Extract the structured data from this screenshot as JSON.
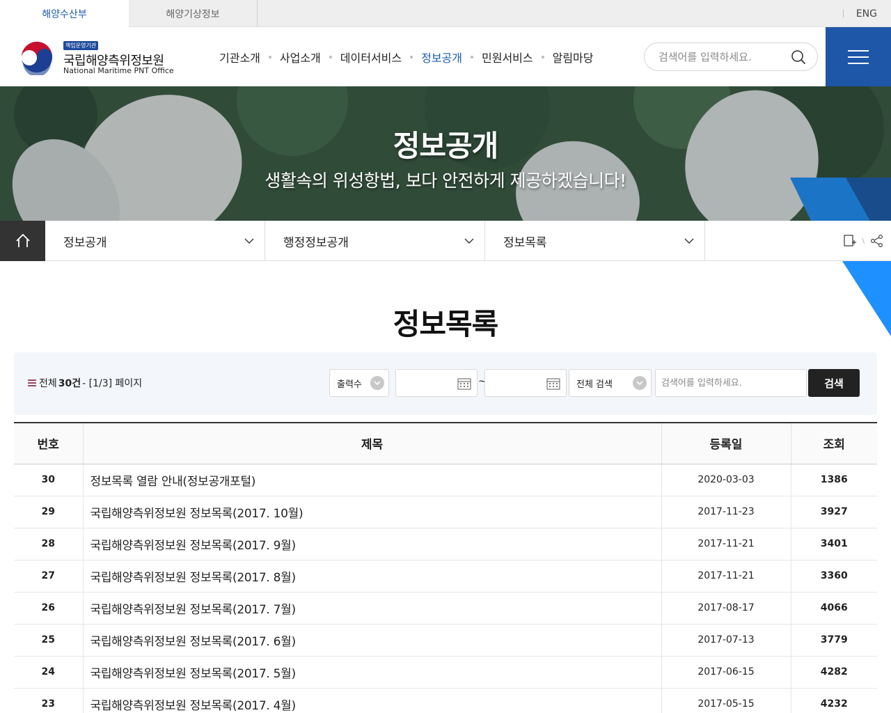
{
  "topbar": {
    "tabs": [
      "해양수산부",
      "해양기상정보"
    ],
    "lang": "ENG"
  },
  "header": {
    "badge": "책임운영기관",
    "org_ko": "국립해양측위정보원",
    "org_en": "National Maritime PNT Office",
    "nav": [
      "기관소개",
      "사업소개",
      "데이터서비스",
      "정보공개",
      "민원서비스",
      "알림마당"
    ],
    "active_nav": "정보공개",
    "search_placeholder": "검색어를 입력하세요."
  },
  "banner": {
    "title": "정보공개",
    "subtitle": "생활속의 위성항법, 보다 안전하게 제공하겠습니다!"
  },
  "location": {
    "items": [
      "정보공개",
      "행정정보공개",
      "정보목록"
    ]
  },
  "page": {
    "title": "정보목록"
  },
  "filter": {
    "total_prefix": "전체",
    "total_count": "30건",
    "page_info": "- [1/3] 페이지",
    "per_page_label": "출력수",
    "tilde": "~",
    "scope_label": "전체 검색",
    "keyword_placeholder": "검색어를 입력하세요.",
    "search_button": "검색"
  },
  "table": {
    "headers": [
      "번호",
      "제목",
      "등록일",
      "조회"
    ],
    "rows": [
      {
        "no": "30",
        "title": "정보목록 열람 안내(정보공개포털)",
        "date": "2020-03-03",
        "hits": "1386"
      },
      {
        "no": "29",
        "title": "국립해양측위정보원 정보목록(2017. 10월)",
        "date": "2017-11-23",
        "hits": "3927"
      },
      {
        "no": "28",
        "title": "국립해양측위정보원 정보목록(2017. 9월)",
        "date": "2017-11-21",
        "hits": "3401"
      },
      {
        "no": "27",
        "title": "국립해양측위정보원 정보목록(2017. 8월)",
        "date": "2017-11-21",
        "hits": "3360"
      },
      {
        "no": "26",
        "title": "국립해양측위정보원 정보목록(2017. 7월)",
        "date": "2017-08-17",
        "hits": "4066"
      },
      {
        "no": "25",
        "title": "국립해양측위정보원 정보목록(2017. 6월)",
        "date": "2017-07-13",
        "hits": "3779"
      },
      {
        "no": "24",
        "title": "국립해양측위정보원 정보목록(2017. 5월)",
        "date": "2017-06-15",
        "hits": "4282"
      },
      {
        "no": "23",
        "title": "국립해양측위정보원 정보목록(2017. 4월)",
        "date": "2017-05-15",
        "hits": "4232"
      }
    ]
  },
  "colors": {
    "brand_blue": "#1e56a8",
    "active_text": "#1a5bb0",
    "accent_cyan": "#1e90ff",
    "dark_button": "#222222"
  }
}
